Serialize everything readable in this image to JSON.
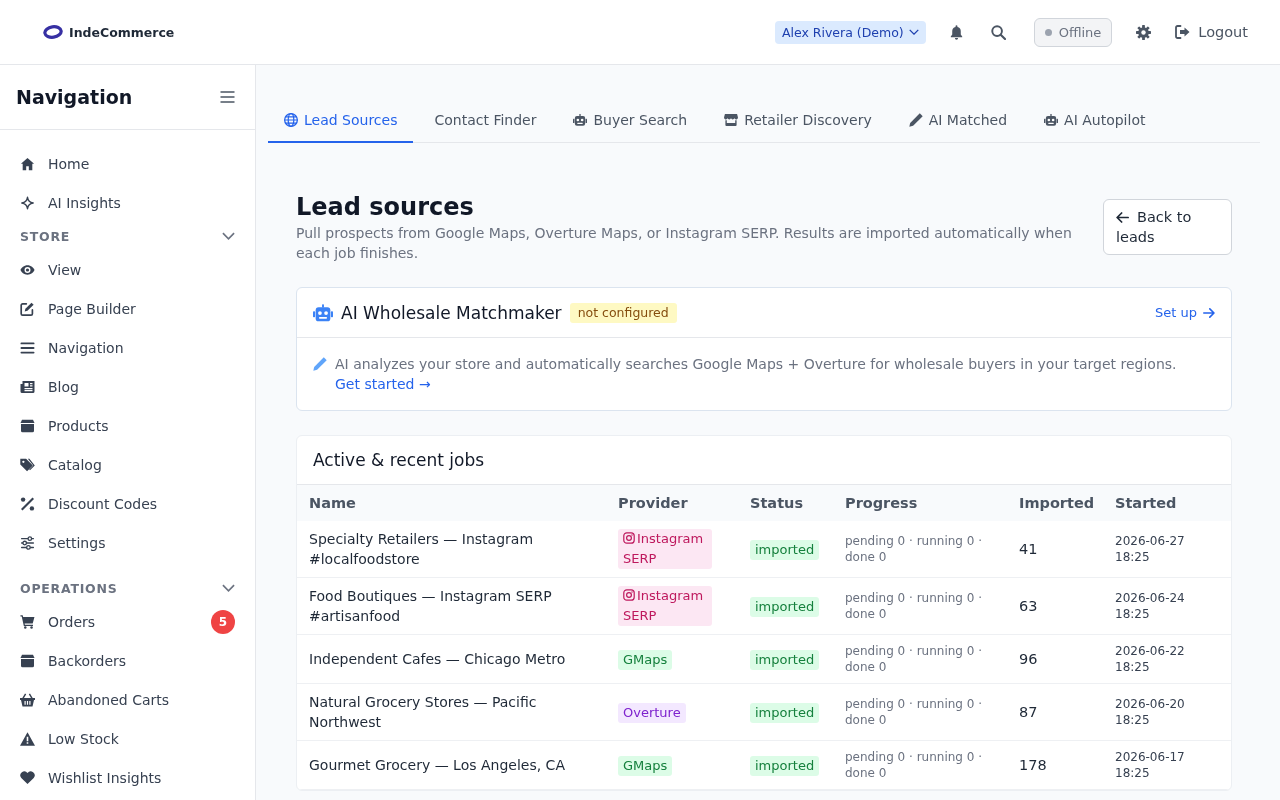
{
  "header": {
    "brand": "IndeCommerce",
    "user_menu": "Alex Rivera (Demo)",
    "connection": {
      "label": "Offline",
      "online": false
    },
    "logout": "Logout"
  },
  "sidebar": {
    "title": "Navigation",
    "sections": [
      {
        "items": [
          {
            "label": "Home",
            "selected": false
          },
          {
            "label": "AI Insights",
            "selected": false
          }
        ]
      },
      {
        "title": "STORE",
        "expanded": true,
        "items": [
          {
            "label": "View",
            "selected": false
          },
          {
            "label": "Page Builder",
            "selected": false
          },
          {
            "label": "Navigation",
            "selected": false
          },
          {
            "label": "Blog",
            "selected": false
          },
          {
            "label": "Products",
            "selected": false
          },
          {
            "label": "Catalog",
            "selected": false
          },
          {
            "label": "Discount Codes",
            "selected": false
          },
          {
            "label": "Settings",
            "selected": false
          }
        ]
      },
      {
        "title": "OPERATIONS",
        "expanded": true,
        "items": [
          {
            "label": "Orders",
            "selected": false,
            "badge": "5"
          },
          {
            "label": "Backorders",
            "selected": false
          },
          {
            "label": "Abandoned Carts",
            "selected": false
          },
          {
            "label": "Low Stock",
            "selected": false
          },
          {
            "label": "Wishlist Insights",
            "selected": false
          }
        ]
      }
    ]
  },
  "tabs": [
    {
      "label": "Lead Sources",
      "selected": true
    },
    {
      "label": "Contact Finder",
      "selected": false
    },
    {
      "label": "Buyer Search",
      "selected": false
    },
    {
      "label": "Retailer Discovery",
      "selected": false
    },
    {
      "label": "AI Matched",
      "selected": false
    },
    {
      "label": "AI Autopilot",
      "selected": false
    }
  ],
  "page": {
    "title": "Lead sources",
    "subtitle": "Pull prospects from Google Maps, Overture Maps, or Instagram SERP. Results are imported automatically when each job finishes.",
    "back_button": "Back to leads"
  },
  "matchmaker": {
    "title": "AI Wholesale Matchmaker",
    "badge": "not configured",
    "setup_link": "Set up",
    "description": "AI analyzes your store and automatically searches Google Maps + Overture for wholesale buyers in your target regions.",
    "link": "Get started →"
  },
  "jobs": {
    "title": "Active & recent jobs",
    "columns": [
      "Name",
      "Provider",
      "Status",
      "Progress",
      "Imported",
      "Started"
    ],
    "rows": [
      {
        "name": "Specialty Retailers — Instagram #localfoodstore",
        "provider": {
          "label": "Instagram SERP",
          "kind": "instagram"
        },
        "status": "imported",
        "progress": "pending 0 · running 0 · done 0",
        "imported": "41",
        "started": "2026-06-27 18:25"
      },
      {
        "name": "Food Boutiques — Instagram SERP #artisanfood",
        "provider": {
          "label": "Instagram SERP",
          "kind": "instagram"
        },
        "status": "imported",
        "progress": "pending 0 · running 0 · done 0",
        "imported": "63",
        "started": "2026-06-24 18:25"
      },
      {
        "name": "Independent Cafes — Chicago Metro",
        "provider": {
          "label": "GMaps",
          "kind": "gmaps"
        },
        "status": "imported",
        "progress": "pending 0 · running 0 · done 0",
        "imported": "96",
        "started": "2026-06-22 18:25"
      },
      {
        "name": "Natural Grocery Stores — Pacific Northwest",
        "provider": {
          "label": "Overture",
          "kind": "overture"
        },
        "status": "imported",
        "progress": "pending 0 · running 0 · done 0",
        "imported": "87",
        "started": "2026-06-20 18:25"
      },
      {
        "name": "Gourmet Grocery — Los Angeles, CA",
        "provider": {
          "label": "GMaps",
          "kind": "gmaps"
        },
        "status": "imported",
        "progress": "pending 0 · running 0 · done 0",
        "imported": "178",
        "started": "2026-06-17 18:25"
      }
    ]
  }
}
